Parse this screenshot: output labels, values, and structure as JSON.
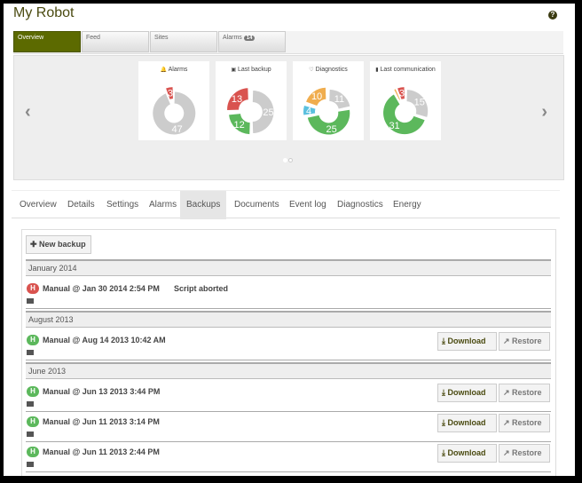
{
  "title": "My Robot",
  "top_tabs": [
    {
      "label": "Overview"
    },
    {
      "label": "Feed"
    },
    {
      "label": "Sites"
    },
    {
      "label": "Alarms",
      "badge": "14"
    }
  ],
  "colors": {
    "red": "#d9534f",
    "gray": "#cccccc",
    "green": "#5cb85c",
    "orange": "#f0ad4e",
    "blue": "#5bc0de",
    "accent": "#5c6a00"
  },
  "cards": [
    {
      "label": "Alarms",
      "icon": "bell-icon",
      "glyph": "🔔",
      "segments": [
        {
          "value": 47,
          "color": "gray"
        },
        {
          "value": 3,
          "color": "red",
          "explode": true
        }
      ]
    },
    {
      "label": "Last backup",
      "icon": "floppy-icon",
      "glyph": "▣",
      "segments": [
        {
          "value": 25,
          "color": "gray"
        },
        {
          "value": 12,
          "color": "green"
        },
        {
          "value": 13,
          "color": "red",
          "explode": true
        }
      ]
    },
    {
      "label": "Diagnostics",
      "icon": "heart-icon",
      "glyph": "♡",
      "segments": [
        {
          "value": 11,
          "color": "gray"
        },
        {
          "value": 25,
          "color": "green"
        },
        {
          "value": 4,
          "color": "blue",
          "explode": true
        },
        {
          "value": 10,
          "color": "orange",
          "explode": true
        }
      ]
    },
    {
      "label": "Last communication",
      "icon": "signal-icon",
      "glyph": "▮",
      "segments": [
        {
          "value": 15,
          "color": "gray"
        },
        {
          "value": 31,
          "color": "green"
        },
        {
          "value": 1,
          "color": "orange",
          "explode": true
        },
        {
          "value": 3,
          "color": "red",
          "explode": true
        }
      ]
    }
  ],
  "nav_tabs": [
    "Overview",
    "Details",
    "Settings",
    "Alarms",
    "Backups",
    "Documents",
    "Event log",
    "Diagnostics",
    "Energy"
  ],
  "active_nav": "Backups",
  "new_backup_label": "New backup",
  "download_label": "Download",
  "restore_label": "Restore",
  "groups": [
    {
      "label": "January 2014",
      "rows": [
        {
          "text": "Manual @ Jan 30 2014 2:54 PM",
          "status": "Script aborted",
          "state": "error",
          "actions": false
        }
      ]
    },
    {
      "label": "August 2013",
      "rows": [
        {
          "text": "Manual @ Aug 14 2013 10:42 AM",
          "status": "",
          "state": "ok",
          "actions": true
        }
      ]
    },
    {
      "label": "June 2013",
      "rows": [
        {
          "text": "Manual @ Jun 13 2013 3:44 PM",
          "status": "",
          "state": "ok",
          "actions": true
        },
        {
          "text": "Manual @ Jun 11 2013 3:14 PM",
          "status": "",
          "state": "ok",
          "actions": true
        },
        {
          "text": "Manual @ Jun 11 2013 2:44 PM",
          "status": "",
          "state": "ok",
          "actions": true
        }
      ]
    }
  ]
}
